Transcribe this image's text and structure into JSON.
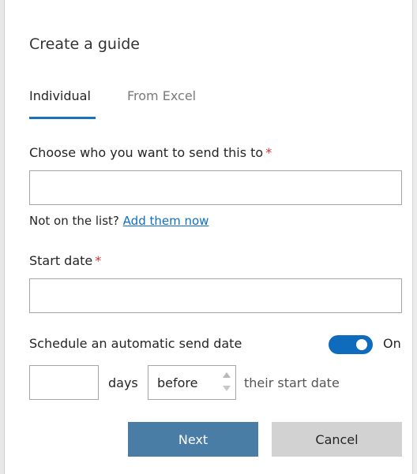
{
  "dialog": {
    "title": "Create a guide"
  },
  "tabs": [
    {
      "label": "Individual",
      "active": true
    },
    {
      "label": "From Excel",
      "active": false
    }
  ],
  "recipients": {
    "label": "Choose who you want to send this to",
    "required_mark": "*",
    "value": ""
  },
  "hint": {
    "text": "Not on the list?",
    "link": "Add them now"
  },
  "start_date": {
    "label": "Start date",
    "required_mark": "*",
    "value": ""
  },
  "schedule": {
    "label": "Schedule an automatic send date",
    "toggle_on": true,
    "toggle_label": "On",
    "days_value": "",
    "days_text": "days",
    "relation_value": "before",
    "after_text": "their start date"
  },
  "buttons": {
    "next": "Next",
    "cancel": "Cancel"
  },
  "colors": {
    "accent": "#0f6cbd",
    "tab_underline": "#1a73b8",
    "primary_button": "#4a7da5",
    "secondary_button": "#d2d2d2",
    "required": "#d13438",
    "link": "#0e6fc0"
  }
}
